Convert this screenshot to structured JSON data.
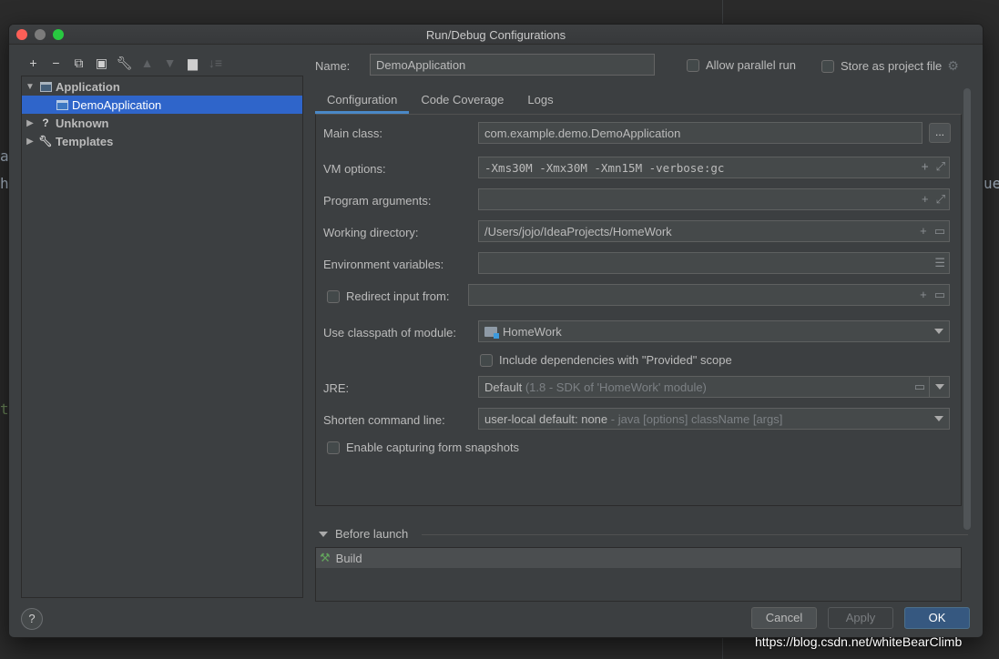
{
  "window": {
    "title": "Run/Debug Configurations"
  },
  "toolbar": {
    "icons": [
      "add-icon",
      "remove-icon",
      "copy-icon",
      "save-icon",
      "wrench-icon",
      "move-up-icon",
      "move-down-icon",
      "folder-icon",
      "sort-icon"
    ]
  },
  "tree": {
    "items": [
      {
        "label": "Application",
        "expanded": true
      },
      {
        "label": "DemoApplication",
        "selected": true
      },
      {
        "label": "Unknown",
        "expanded": false
      },
      {
        "label": "Templates",
        "expanded": false
      }
    ]
  },
  "header": {
    "name_label": "Name:",
    "name_value": "DemoApplication",
    "allow_parallel": "Allow parallel run",
    "store_as_project": "Store as project file"
  },
  "tabs": [
    "Configuration",
    "Code Coverage",
    "Logs"
  ],
  "form": {
    "main_class_label": "Main class:",
    "main_class_value": "com.example.demo.DemoApplication",
    "main_class_btn": "...",
    "vm_options_label": "VM options:",
    "vm_options_value": "-Xms30M -Xmx30M -Xmn15M -verbose:gc",
    "program_args_label": "Program arguments:",
    "working_dir_label": "Working directory:",
    "working_dir_value": "/Users/jojo/IdeaProjects/HomeWork",
    "env_vars_label": "Environment variables:",
    "redirect_label": "Redirect input from:",
    "classpath_label": "Use classpath of module:",
    "classpath_value": "HomeWork",
    "include_deps_label": "Include dependencies with \"Provided\" scope",
    "jre_label": "JRE:",
    "jre_value": "Default",
    "jre_detail": "(1.8 - SDK of 'HomeWork' module)",
    "shorten_label": "Shorten command line:",
    "shorten_value": "user-local default: none",
    "shorten_detail": "- java [options] className [args]",
    "snapshots_label": "Enable capturing form snapshots"
  },
  "before_launch": {
    "title": "Before launch",
    "items": [
      "Build"
    ]
  },
  "buttons": {
    "help": "?",
    "cancel": "Cancel",
    "apply": "Apply",
    "ok": "OK"
  },
  "background": {
    "watermark": "https://blog.csdn.net/whiteBearClimb"
  }
}
